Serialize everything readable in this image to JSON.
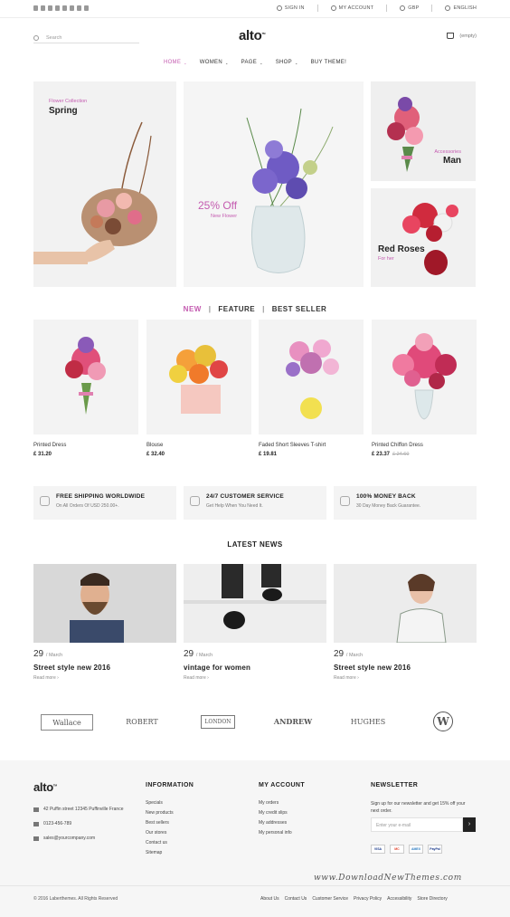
{
  "topbar": {
    "social_icons": [
      "facebook-icon",
      "twitter-icon",
      "rss-icon",
      "youtube-icon",
      "google-plus-icon",
      "pinterest-icon",
      "vimeo-icon",
      "instagram-icon"
    ],
    "sign_in": "SIGN IN",
    "my_account": "MY ACCOUNT",
    "currency": "GBP",
    "language": "ENGLISH"
  },
  "header": {
    "search_placeholder": "Search",
    "logo": "alto",
    "logo_tm": "TM",
    "cart_text": "(empty)"
  },
  "nav": {
    "items": [
      {
        "label": "HOME",
        "dropdown": true
      },
      {
        "label": "WOMEN",
        "dropdown": true
      },
      {
        "label": "PAGE",
        "dropdown": true
      },
      {
        "label": "SHOP",
        "dropdown": true
      },
      {
        "label": "BUY THEME!",
        "dropdown": false
      }
    ]
  },
  "banners": {
    "b1": {
      "small": "Flower Collection",
      "big": "Spring"
    },
    "b2": {
      "big": "25% Off",
      "small": "New Flower"
    },
    "b3": {
      "small": "Accessories",
      "big": "Man"
    },
    "b4": {
      "big": "Red Roses",
      "small": "For her"
    }
  },
  "tabs": {
    "new": "NEW",
    "feature": "FEATURE",
    "best": "BEST SELLER",
    "sep": "|"
  },
  "products": [
    {
      "name": "Printed Dress",
      "price": "£ 31.20",
      "old_price": ""
    },
    {
      "name": "Blouse",
      "price": "£ 32.40",
      "old_price": ""
    },
    {
      "name": "Faded Short Sleeves T-shirt",
      "price": "£ 19.81",
      "old_price": ""
    },
    {
      "name": "Printed Chiffon Dress",
      "price": "£ 23.37",
      "old_price": "£ 24.60"
    }
  ],
  "features": [
    {
      "title": "FREE SHIPPING WORLDWIDE",
      "sub": "On All Orders Of USD 250.00+.",
      "icon": "airplane-icon"
    },
    {
      "title": "24/7 CUSTOMER SERVICE",
      "sub": "Get Help When You Need It.",
      "icon": "headset-icon"
    },
    {
      "title": "100% MONEY BACK",
      "sub": "30 Day Money Back Guarantee.",
      "icon": "refresh-icon"
    }
  ],
  "latest_news": {
    "title": "LATEST NEWS",
    "posts": [
      {
        "day": "29",
        "month": "/ March",
        "title": "Street style new 2016",
        "more": "Read more ›"
      },
      {
        "day": "29",
        "month": "/ March",
        "title": "vintage for women",
        "more": "Read more ›"
      },
      {
        "day": "29",
        "month": "/ March",
        "title": "Street style new 2016",
        "more": "Read more ›"
      }
    ]
  },
  "brands": [
    "Wallace",
    "ROBERT",
    "LONDON",
    "ANDREW",
    "HUGHES",
    "W"
  ],
  "footer": {
    "logo": "alto",
    "address": "42 Puffin street 12345 Puffinville France",
    "phone": "0123-456-789",
    "email": "sales@yourcompany.com",
    "information": {
      "title": "INFORMATION",
      "links": [
        "Specials",
        "New products",
        "Best sellers",
        "Our stores",
        "Contact us",
        "Sitemap"
      ]
    },
    "my_account": {
      "title": "MY ACCOUNT",
      "links": [
        "My orders",
        "My credit slips",
        "My addresses",
        "My personal info"
      ]
    },
    "newsletter": {
      "title": "NEWSLETTER",
      "text1": "Sign up for our newsletter and get 15% off your",
      "text2": "next order.",
      "placeholder": "Enter your e-mail",
      "button": "›"
    },
    "payments": [
      "VISA",
      "MC",
      "AMEX",
      "PayPal"
    ],
    "copyright": "© 2016 Laberthemes. All Rights Reserved",
    "bottom_links": [
      "About Us",
      "Contact Us",
      "Customer Service",
      "Privacy Policy",
      "Accessibility",
      "Store Directory"
    ],
    "watermark": "www.DownloadNewThemes.com"
  },
  "colors": {
    "accent": "#c45bb0",
    "dark": "#222222"
  }
}
